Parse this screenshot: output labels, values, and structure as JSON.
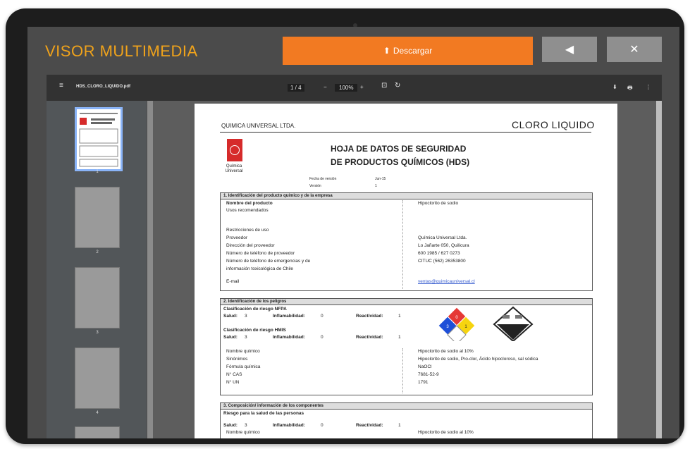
{
  "app": {
    "title": "VISOR MULTIMEDIA",
    "download_label": "Descargar",
    "back_glyph": "◀",
    "close_glyph": "✕",
    "accent_color": "#f0a31b",
    "download_color": "#f27a22"
  },
  "pdf_toolbar": {
    "menu_glyph": "≡",
    "file_name": "HDS_CLORO_LIQUIDO.pdf",
    "page_indicator": "1 / 4",
    "zoom_out_glyph": "−",
    "zoom": "100%",
    "zoom_in_glyph": "+",
    "fit_glyph": "⊡",
    "rotate_glyph": "↻",
    "download_glyph": "⬇",
    "print_glyph": "🖶",
    "more_glyph": "⋮"
  },
  "thumbnails": [
    {
      "num": "1",
      "selected": true
    },
    {
      "num": "2",
      "selected": false
    },
    {
      "num": "3",
      "selected": false
    },
    {
      "num": "4",
      "selected": false
    }
  ],
  "document": {
    "company": "QUIMICA UNIVERSAL LTDA.",
    "product": "CLORO LIQUIDO",
    "logo_text": "Química Universal",
    "title_line1": "HOJA DE DATOS DE SEGURIDAD",
    "title_line2": "DE PRODUCTOS QUÍMICOS (HDS)",
    "meta": {
      "date_label": "Fecha de versión",
      "date_value": "Jun-15",
      "version_label": "Versión",
      "version_value": "1"
    },
    "section1": {
      "title": "1.   Identificación del producto químico y de la empresa",
      "rows": [
        {
          "label": "Nombre del producto",
          "value": "Hipoclorito de sodio",
          "bold": true
        },
        {
          "label": "Usos recomendados",
          "value": ""
        },
        {
          "label": "Restricciones de uso",
          "value": ""
        },
        {
          "label": "Proveedor",
          "value": "Química Universal Ltda."
        },
        {
          "label": "Dirección del proveedor",
          "value": "Lo Jañarte 050, Quilicura"
        },
        {
          "label": "Número de teléfono de proveedor",
          "value": "600 1985 / 627 0273"
        },
        {
          "label": "Número de teléfono de emergencias y de",
          "value": "CITUC (562) 26353800"
        },
        {
          "label": "información toxicológica de Chile",
          "value": ""
        },
        {
          "label": "E-mail",
          "value": "ventas@quimicauniversal.cl"
        }
      ]
    },
    "section2": {
      "title": "2.   Identificación de los peligros",
      "nfpa_title": "Clasificación de riesgo NFPA",
      "hmis_title": "Clasificación de riesgo HMIS",
      "salud_label": "Salud:",
      "salud_value": "3",
      "infl_label": "Inflamabilidad:",
      "infl_value": "0",
      "reac_label": "Reactividad:",
      "reac_value": "1",
      "nfpa_values": {
        "health": "3",
        "fire": "0",
        "reactivity": "1"
      },
      "rows": [
        {
          "label": "Nombre químico",
          "value": "Hipoclorito de sodio al 10%"
        },
        {
          "label": "Sinónimos",
          "value": "Hipoclorito de sodio, Pro-clor, Ácido hipocloroso, sal sódica"
        },
        {
          "label": "Fórmula química",
          "value": "NaOCl"
        },
        {
          "label": "N° CAS",
          "value": "7681-52-9"
        },
        {
          "label": "N° UN",
          "value": "1791"
        }
      ]
    },
    "section3": {
      "title": "3.   Composición/ información de los componentes",
      "subtitle": "Riesgo para la salud de las personas",
      "name_label": "Nombre químico",
      "name_value": "Hipoclorito de sodio al 10%"
    }
  }
}
